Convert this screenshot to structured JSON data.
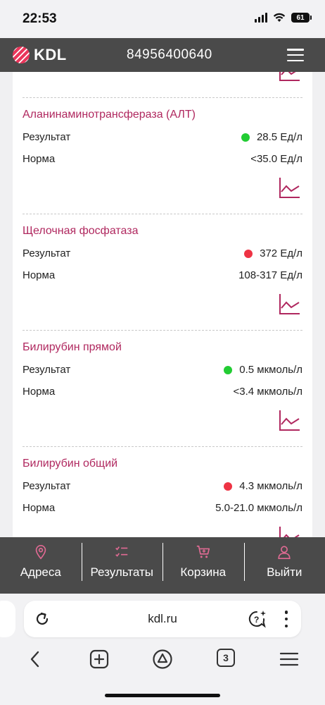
{
  "status_bar": {
    "time": "22:53",
    "battery": "61"
  },
  "header": {
    "logo_text": "KDL",
    "phone": "84956400640"
  },
  "labels": {
    "result": "Результат",
    "norm": "Норма"
  },
  "analytes": [
    {
      "name": "Аланинаминотрансфераза (АЛТ)",
      "result": "28.5 Ед/л",
      "status": "normal",
      "norm": "<35.0 Ед/л"
    },
    {
      "name": "Щелочная фосфатаза",
      "result": "372 Ед/л",
      "status": "abnormal",
      "norm": "108-317 Ед/л"
    },
    {
      "name": "Билирубин прямой",
      "result": "0.5 мкмоль/л",
      "status": "normal",
      "norm": "<3.4 мкмоль/л"
    },
    {
      "name": "Билирубин общий",
      "result": "4.3 мкмоль/л",
      "status": "abnormal",
      "norm": "5.0-21.0 мкмоль/л"
    }
  ],
  "colors": {
    "accent": "#b0285f",
    "normal": "#22cc33",
    "abnormal": "#ee3344",
    "nav_bg": "#4a4a4a"
  },
  "bottom_nav": [
    {
      "label": "Адреса",
      "icon": "location-pin-icon"
    },
    {
      "label": "Результаты",
      "icon": "checklist-icon"
    },
    {
      "label": "Корзина",
      "icon": "cart-icon"
    },
    {
      "label": "Выйти",
      "icon": "user-icon"
    }
  ],
  "browser": {
    "url": "kdl.ru",
    "tab_count": "3"
  }
}
